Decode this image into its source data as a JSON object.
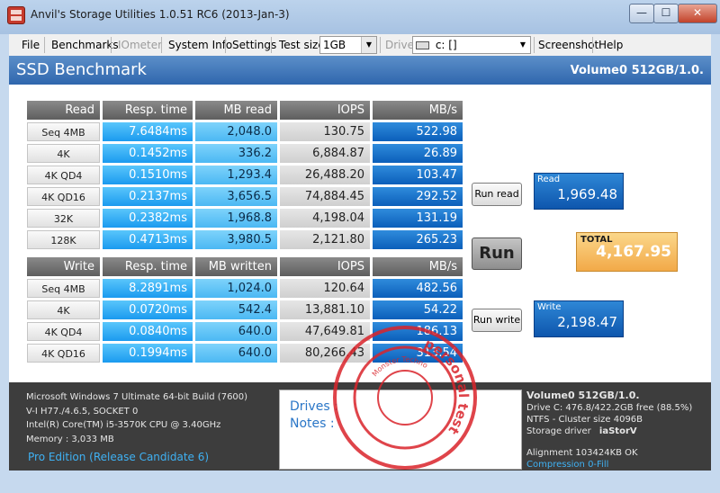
{
  "window": {
    "title": "Anvil's Storage Utilities 1.0.51 RC6 (2013-Jan-3)",
    "min_glyph": "—",
    "max_glyph": "☐",
    "close_glyph": "✕"
  },
  "menu": {
    "file": "File",
    "benchmarks": "Benchmarks",
    "iometer": "IOmeter",
    "system_info": "System Info",
    "settings": "Settings",
    "test_size_label": "Test size",
    "test_size_value": "1GB",
    "drive_label": "Drive",
    "drive_value": "c: []",
    "screenshot": "Screenshot",
    "help": "Help"
  },
  "header": {
    "title": "SSD Benchmark",
    "volume": "Volume0 512GB/1.0."
  },
  "read": {
    "headers": [
      "Read",
      "Resp. time",
      "MB read",
      "IOPS",
      "MB/s"
    ],
    "rows": [
      {
        "label": "Seq 4MB",
        "resp": "7.6484ms",
        "mb": "2,048.0",
        "iops": "130.75",
        "mbs": "522.98"
      },
      {
        "label": "4K",
        "resp": "0.1452ms",
        "mb": "336.2",
        "iops": "6,884.87",
        "mbs": "26.89"
      },
      {
        "label": "4K QD4",
        "resp": "0.1510ms",
        "mb": "1,293.4",
        "iops": "26,488.20",
        "mbs": "103.47"
      },
      {
        "label": "4K QD16",
        "resp": "0.2137ms",
        "mb": "3,656.5",
        "iops": "74,884.45",
        "mbs": "292.52"
      },
      {
        "label": "32K",
        "resp": "0.2382ms",
        "mb": "1,968.8",
        "iops": "4,198.04",
        "mbs": "131.19"
      },
      {
        "label": "128K",
        "resp": "0.4713ms",
        "mb": "3,980.5",
        "iops": "2,121.80",
        "mbs": "265.23"
      }
    ]
  },
  "write": {
    "headers": [
      "Write",
      "Resp. time",
      "MB written",
      "IOPS",
      "MB/s"
    ],
    "rows": [
      {
        "label": "Seq 4MB",
        "resp": "8.2891ms",
        "mb": "1,024.0",
        "iops": "120.64",
        "mbs": "482.56"
      },
      {
        "label": "4K",
        "resp": "0.0720ms",
        "mb": "542.4",
        "iops": "13,881.10",
        "mbs": "54.22"
      },
      {
        "label": "4K QD4",
        "resp": "0.0840ms",
        "mb": "640.0",
        "iops": "47,649.81",
        "mbs": "186.13"
      },
      {
        "label": "4K QD16",
        "resp": "0.1994ms",
        "mb": "640.0",
        "iops": "80,266.43",
        "mbs": "313.54"
      }
    ]
  },
  "buttons": {
    "run_read": "Run read",
    "run": "Run",
    "run_write": "Run write"
  },
  "scores": {
    "read_label": "Read",
    "read_value": "1,969.48",
    "total_label": "TOTAL",
    "total_value": "4,167.95",
    "write_label": "Write",
    "write_value": "2,198.47"
  },
  "system_info": {
    "lines": [
      "Microsoft Windows 7 Ultimate  64-bit Build (7600)",
      "V-I H77./4.6.5, SOCKET 0",
      "Intel(R) Core(TM) i5-3570K CPU @ 3.40GHz",
      "Memory : 3,033 MB"
    ],
    "edition": "Pro Edition (Release Candidate 6)"
  },
  "notes": {
    "drives_label": "Drives :",
    "notes_label": "Notes :"
  },
  "drive_info": {
    "volume": "Volume0 512GB/1.0.",
    "drive_c": "Drive C: 476.8/422.2GB free (88.5%)",
    "ntfs": "NTFS - Cluster size 4096B",
    "storage_driver_label": "Storage driver",
    "storage_driver_value": "iaStorV",
    "alignment": "Alignment 103424KB OK",
    "compression": "Compression 0-Fill"
  },
  "stamp": {
    "top_text": "personal test",
    "inner_text": "Monster Techno",
    "color": "#d9232a"
  }
}
